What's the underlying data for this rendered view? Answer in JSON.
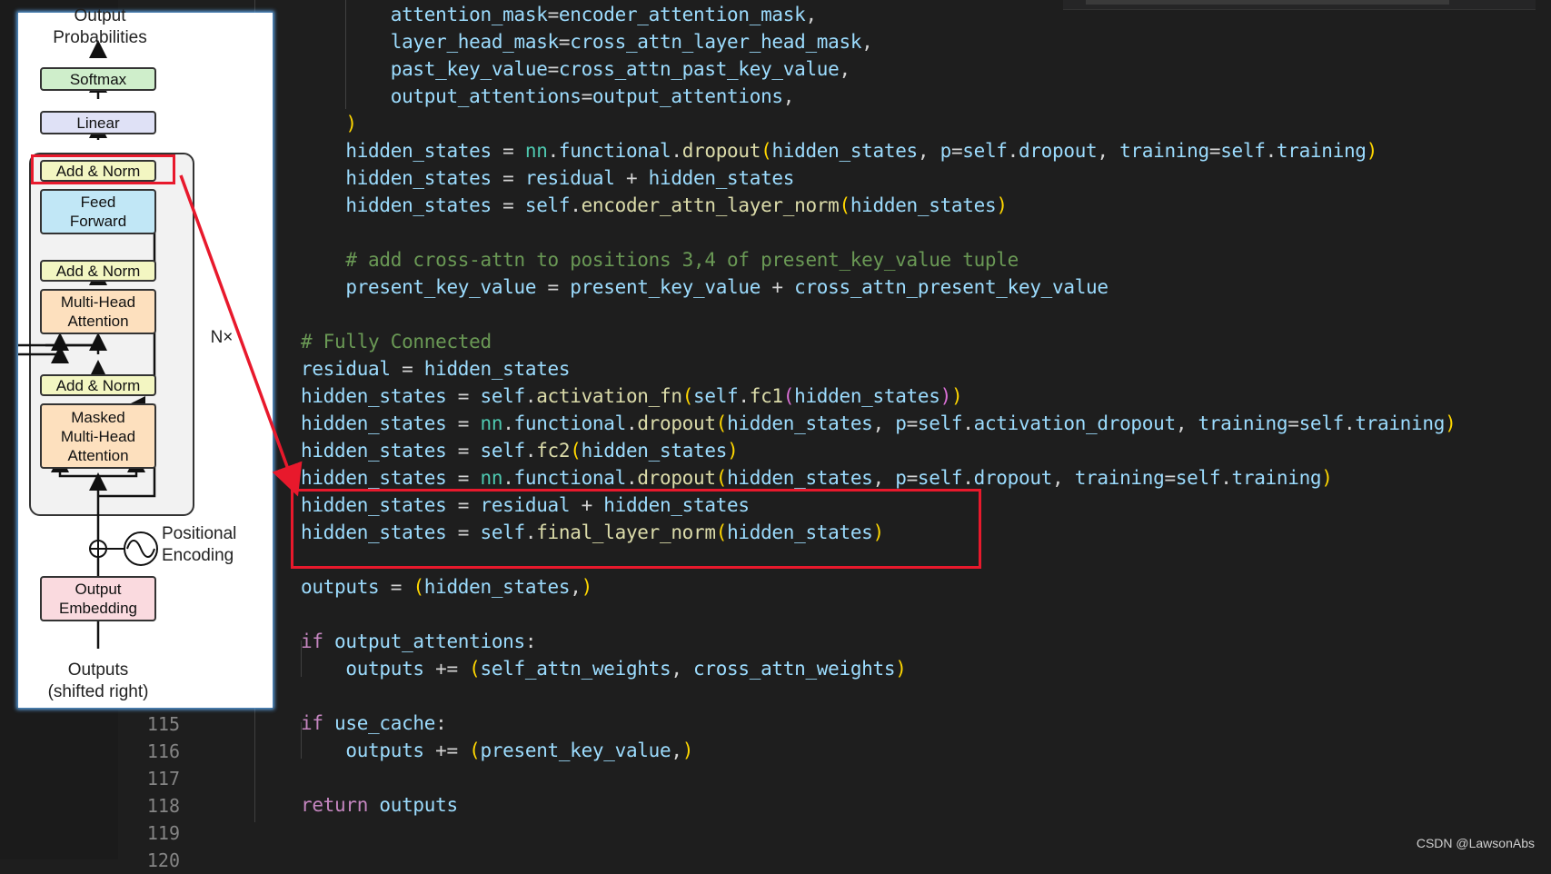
{
  "editor": {
    "line_numbers_visible": [
      "115",
      "116",
      "117",
      "118",
      "119",
      "120"
    ],
    "lines": [
      [
        {
          "t": "        attention_mask",
          "c": "var"
        },
        {
          "t": "=",
          "c": "op"
        },
        {
          "t": "encoder_attention_mask",
          "c": "var"
        },
        {
          "t": ",",
          "c": "op"
        }
      ],
      [
        {
          "t": "        layer_head_mask",
          "c": "var"
        },
        {
          "t": "=",
          "c": "op"
        },
        {
          "t": "cross_attn_layer_head_mask",
          "c": "var"
        },
        {
          "t": ",",
          "c": "op"
        }
      ],
      [
        {
          "t": "        past_key_value",
          "c": "var"
        },
        {
          "t": "=",
          "c": "op"
        },
        {
          "t": "cross_attn_past_key_value",
          "c": "var"
        },
        {
          "t": ",",
          "c": "op"
        }
      ],
      [
        {
          "t": "        output_attentions",
          "c": "var"
        },
        {
          "t": "=",
          "c": "op"
        },
        {
          "t": "output_attentions",
          "c": "var"
        },
        {
          "t": ",",
          "c": "op"
        }
      ],
      [
        {
          "t": "    )",
          "c": "p1"
        }
      ],
      [
        {
          "t": "    hidden_states",
          "c": "var"
        },
        {
          "t": " = ",
          "c": "op"
        },
        {
          "t": "nn",
          "c": "cls"
        },
        {
          "t": ".",
          "c": "op"
        },
        {
          "t": "functional",
          "c": "var"
        },
        {
          "t": ".",
          "c": "op"
        },
        {
          "t": "dropout",
          "c": "fn"
        },
        {
          "t": "(",
          "c": "p1"
        },
        {
          "t": "hidden_states",
          "c": "var"
        },
        {
          "t": ", ",
          "c": "op"
        },
        {
          "t": "p",
          "c": "var"
        },
        {
          "t": "=",
          "c": "op"
        },
        {
          "t": "self",
          "c": "var"
        },
        {
          "t": ".",
          "c": "op"
        },
        {
          "t": "dropout",
          "c": "var"
        },
        {
          "t": ", ",
          "c": "op"
        },
        {
          "t": "training",
          "c": "var"
        },
        {
          "t": "=",
          "c": "op"
        },
        {
          "t": "self",
          "c": "var"
        },
        {
          "t": ".",
          "c": "op"
        },
        {
          "t": "training",
          "c": "var"
        },
        {
          "t": ")",
          "c": "p1"
        }
      ],
      [
        {
          "t": "    hidden_states",
          "c": "var"
        },
        {
          "t": " = ",
          "c": "op"
        },
        {
          "t": "residual",
          "c": "var"
        },
        {
          "t": " + ",
          "c": "op"
        },
        {
          "t": "hidden_states",
          "c": "var"
        }
      ],
      [
        {
          "t": "    hidden_states",
          "c": "var"
        },
        {
          "t": " = ",
          "c": "op"
        },
        {
          "t": "self",
          "c": "var"
        },
        {
          "t": ".",
          "c": "op"
        },
        {
          "t": "encoder_attn_layer_norm",
          "c": "fn"
        },
        {
          "t": "(",
          "c": "p1"
        },
        {
          "t": "hidden_states",
          "c": "var"
        },
        {
          "t": ")",
          "c": "p1"
        }
      ],
      [],
      [
        {
          "t": "    # add cross-attn to positions 3,4 of present_key_value tuple",
          "c": "com"
        }
      ],
      [
        {
          "t": "    present_key_value",
          "c": "var"
        },
        {
          "t": " = ",
          "c": "op"
        },
        {
          "t": "present_key_value",
          "c": "var"
        },
        {
          "t": " + ",
          "c": "op"
        },
        {
          "t": "cross_attn_present_key_value",
          "c": "var"
        }
      ],
      [],
      [
        {
          "t": "# Fully Connected",
          "c": "com"
        }
      ],
      [
        {
          "t": "residual",
          "c": "var"
        },
        {
          "t": " = ",
          "c": "op"
        },
        {
          "t": "hidden_states",
          "c": "var"
        }
      ],
      [
        {
          "t": "hidden_states",
          "c": "var"
        },
        {
          "t": " = ",
          "c": "op"
        },
        {
          "t": "self",
          "c": "var"
        },
        {
          "t": ".",
          "c": "op"
        },
        {
          "t": "activation_fn",
          "c": "fn"
        },
        {
          "t": "(",
          "c": "p1"
        },
        {
          "t": "self",
          "c": "var"
        },
        {
          "t": ".",
          "c": "op"
        },
        {
          "t": "fc1",
          "c": "fn"
        },
        {
          "t": "(",
          "c": "p2"
        },
        {
          "t": "hidden_states",
          "c": "var"
        },
        {
          "t": ")",
          "c": "p2"
        },
        {
          "t": ")",
          "c": "p1"
        }
      ],
      [
        {
          "t": "hidden_states",
          "c": "var"
        },
        {
          "t": " = ",
          "c": "op"
        },
        {
          "t": "nn",
          "c": "cls"
        },
        {
          "t": ".",
          "c": "op"
        },
        {
          "t": "functional",
          "c": "var"
        },
        {
          "t": ".",
          "c": "op"
        },
        {
          "t": "dropout",
          "c": "fn"
        },
        {
          "t": "(",
          "c": "p1"
        },
        {
          "t": "hidden_states",
          "c": "var"
        },
        {
          "t": ", ",
          "c": "op"
        },
        {
          "t": "p",
          "c": "var"
        },
        {
          "t": "=",
          "c": "op"
        },
        {
          "t": "self",
          "c": "var"
        },
        {
          "t": ".",
          "c": "op"
        },
        {
          "t": "activation_dropout",
          "c": "var"
        },
        {
          "t": ", ",
          "c": "op"
        },
        {
          "t": "training",
          "c": "var"
        },
        {
          "t": "=",
          "c": "op"
        },
        {
          "t": "self",
          "c": "var"
        },
        {
          "t": ".",
          "c": "op"
        },
        {
          "t": "training",
          "c": "var"
        },
        {
          "t": ")",
          "c": "p1"
        }
      ],
      [
        {
          "t": "hidden_states",
          "c": "var"
        },
        {
          "t": " = ",
          "c": "op"
        },
        {
          "t": "self",
          "c": "var"
        },
        {
          "t": ".",
          "c": "op"
        },
        {
          "t": "fc2",
          "c": "fn"
        },
        {
          "t": "(",
          "c": "p1"
        },
        {
          "t": "hidden_states",
          "c": "var"
        },
        {
          "t": ")",
          "c": "p1"
        }
      ],
      [
        {
          "t": "hidden_states",
          "c": "var"
        },
        {
          "t": " = ",
          "c": "op"
        },
        {
          "t": "nn",
          "c": "cls"
        },
        {
          "t": ".",
          "c": "op"
        },
        {
          "t": "functional",
          "c": "var"
        },
        {
          "t": ".",
          "c": "op"
        },
        {
          "t": "dropout",
          "c": "fn"
        },
        {
          "t": "(",
          "c": "p1"
        },
        {
          "t": "hidden_states",
          "c": "var"
        },
        {
          "t": ", ",
          "c": "op"
        },
        {
          "t": "p",
          "c": "var"
        },
        {
          "t": "=",
          "c": "op"
        },
        {
          "t": "self",
          "c": "var"
        },
        {
          "t": ".",
          "c": "op"
        },
        {
          "t": "dropout",
          "c": "var"
        },
        {
          "t": ", ",
          "c": "op"
        },
        {
          "t": "training",
          "c": "var"
        },
        {
          "t": "=",
          "c": "op"
        },
        {
          "t": "self",
          "c": "var"
        },
        {
          "t": ".",
          "c": "op"
        },
        {
          "t": "training",
          "c": "var"
        },
        {
          "t": ")",
          "c": "p1"
        }
      ],
      [
        {
          "t": "hidden_states",
          "c": "var"
        },
        {
          "t": " = ",
          "c": "op"
        },
        {
          "t": "residual",
          "c": "var"
        },
        {
          "t": " + ",
          "c": "op"
        },
        {
          "t": "hidden_states",
          "c": "var"
        }
      ],
      [
        {
          "t": "hidden_states",
          "c": "var"
        },
        {
          "t": " = ",
          "c": "op"
        },
        {
          "t": "self",
          "c": "var"
        },
        {
          "t": ".",
          "c": "op"
        },
        {
          "t": "final_layer_norm",
          "c": "fn"
        },
        {
          "t": "(",
          "c": "p1"
        },
        {
          "t": "hidden_states",
          "c": "var"
        },
        {
          "t": ")",
          "c": "p1"
        }
      ],
      [],
      [
        {
          "t": "outputs",
          "c": "var"
        },
        {
          "t": " = ",
          "c": "op"
        },
        {
          "t": "(",
          "c": "p1"
        },
        {
          "t": "hidden_states",
          "c": "var"
        },
        {
          "t": ",",
          "c": "op"
        },
        {
          "t": ")",
          "c": "p1"
        }
      ],
      [],
      [
        {
          "t": "if",
          "c": "kw"
        },
        {
          "t": " ",
          "c": "op"
        },
        {
          "t": "output_attentions",
          "c": "var"
        },
        {
          "t": ":",
          "c": "op"
        }
      ],
      [
        {
          "t": "    outputs",
          "c": "var"
        },
        {
          "t": " += ",
          "c": "op"
        },
        {
          "t": "(",
          "c": "p1"
        },
        {
          "t": "self_attn_weights",
          "c": "var"
        },
        {
          "t": ", ",
          "c": "op"
        },
        {
          "t": "cross_attn_weights",
          "c": "var"
        },
        {
          "t": ")",
          "c": "p1"
        }
      ],
      [],
      [
        {
          "t": "if",
          "c": "kw"
        },
        {
          "t": " ",
          "c": "op"
        },
        {
          "t": "use_cache",
          "c": "var"
        },
        {
          "t": ":",
          "c": "op"
        }
      ],
      [
        {
          "t": "    outputs",
          "c": "var"
        },
        {
          "t": " += ",
          "c": "op"
        },
        {
          "t": "(",
          "c": "p1"
        },
        {
          "t": "present_key_value",
          "c": "var"
        },
        {
          "t": ",",
          "c": "op"
        },
        {
          "t": ")",
          "c": "p1"
        }
      ],
      [],
      [
        {
          "t": "return",
          "c": "kw"
        },
        {
          "t": " ",
          "c": "op"
        },
        {
          "t": "outputs",
          "c": "var"
        }
      ],
      []
    ]
  },
  "diagram": {
    "output_probabilities": "Output\nProbabilities",
    "softmax": "Softmax",
    "linear": "Linear",
    "add_norm": "Add & Norm",
    "feed_forward": "Feed\nForward",
    "multi_head_attention": "Multi-Head\nAttention",
    "masked_multi_head_attention": "Masked\nMulti-Head\nAttention",
    "nx": "N×",
    "positional_encoding": "Positional\nEncoding",
    "output_embedding": "Output\nEmbedding",
    "outputs": "Outputs\n(shifted right)"
  },
  "watermark": "CSDN @LawsonAbs",
  "colors": {
    "highlight": "#e8192c",
    "editor_bg": "#1e1e1e"
  }
}
